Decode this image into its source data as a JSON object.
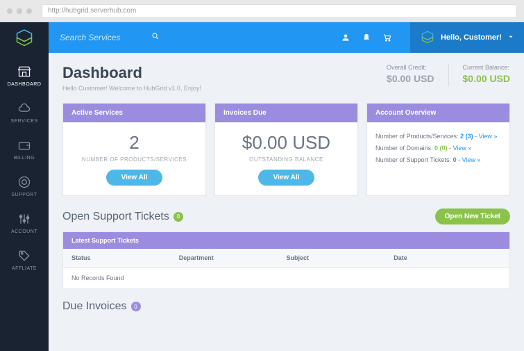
{
  "browser": {
    "url": "http://hubgrid.serverhub.com"
  },
  "sidebar": {
    "items": [
      {
        "label": "DASHBOARD"
      },
      {
        "label": "SERVICES"
      },
      {
        "label": "BILLING"
      },
      {
        "label": "SUPPORT"
      },
      {
        "label": "ACCOUNT"
      },
      {
        "label": "AFFLIATE"
      }
    ]
  },
  "topbar": {
    "search_placeholder": "Search Services",
    "greeting": "Hello, Customer!"
  },
  "page": {
    "title": "Dashboard",
    "subtitle": "Hello Customer! Welcome to HubGrid v1.0, Enjoy!"
  },
  "balances": {
    "credit_label": "Overall Credit:",
    "credit_value": "$0.00 USD",
    "balance_label": "Current Balance:",
    "balance_value": "$0.00 USD"
  },
  "cards": {
    "active": {
      "header": "Active Services",
      "value": "2",
      "sub": "NUMBER OF PRODUCTS/SERVICES",
      "btn": "View All"
    },
    "invoices": {
      "header": "Invoices Due",
      "value": "$0.00 USD",
      "sub": "OUTSTANDING BALANCE",
      "btn": "View All"
    },
    "overview": {
      "header": "Account Overview",
      "products_label": "Number of Products/Services:",
      "products_value": "2 (3)",
      "domains_label": "Number of Domains:",
      "domains_value": "0 (0)",
      "tickets_label": "Number of Support Tickets:",
      "tickets_value": "0",
      "view": "View »"
    }
  },
  "tickets": {
    "title": "Open Support Tickets",
    "count": "0",
    "new_btn": "Open New Ticket",
    "table_header": "Latest Support Tickets",
    "cols": {
      "status": "Status",
      "department": "Department",
      "subject": "Subject",
      "date": "Date"
    },
    "empty": "No Records Found"
  },
  "due_invoices": {
    "title": "Due Invoices",
    "count": "0"
  }
}
